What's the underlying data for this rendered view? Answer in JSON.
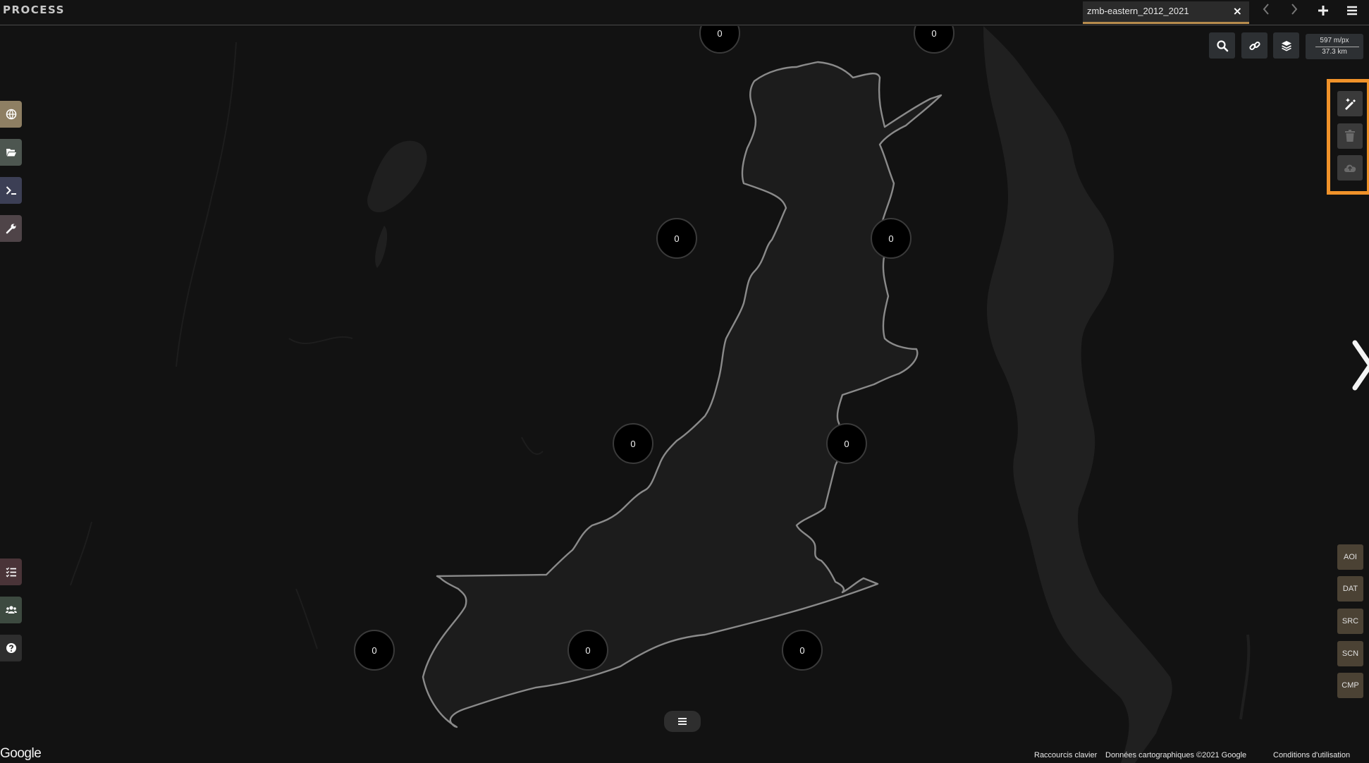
{
  "app": {
    "title": "PROCESS"
  },
  "tab": {
    "label": "zmb-eastern_2012_2021",
    "close_label": "×"
  },
  "top_controls": [
    "chevron-left-icon",
    "chevron-right-icon",
    "plus-icon",
    "hamburger-icon"
  ],
  "map_tools": [
    "search-icon",
    "link-icon",
    "layers-icon"
  ],
  "scale": {
    "resolution": "597 m/px",
    "distance": "37.3 km"
  },
  "left_sidebar": [
    {
      "icon": "globe-icon",
      "color": "#8e7f63"
    },
    {
      "icon": "folder-open-icon",
      "color": "#4d5650"
    },
    {
      "icon": "terminal-icon",
      "color": "#3c3f55"
    },
    {
      "icon": "wrench-icon",
      "color": "#4f4448"
    },
    {
      "icon": "tasks-list-icon",
      "color": "#4a3438"
    },
    {
      "icon": "users-icon",
      "color": "#3d4a40"
    },
    {
      "icon": "help-icon",
      "color": "#2e2e2e"
    }
  ],
  "draw_tools": [
    "draw-polygon-icon",
    "trash-icon",
    "cloud-upload-icon"
  ],
  "highlight_color": "#f0922a",
  "layer_buttons": [
    "AOI",
    "DAT",
    "SRC",
    "SCN",
    "CMP"
  ],
  "clusters": [
    {
      "id": "a",
      "count": "0"
    },
    {
      "id": "b",
      "count": "0"
    },
    {
      "id": "c",
      "count": "0"
    },
    {
      "id": "d",
      "count": "0"
    },
    {
      "id": "e",
      "count": "0"
    },
    {
      "id": "f",
      "count": "0"
    },
    {
      "id": "g",
      "count": "0"
    },
    {
      "id": "h",
      "count": "0"
    },
    {
      "id": "i",
      "count": "0"
    }
  ],
  "bottom_menu_icon": "hamburger-icon",
  "footer": {
    "logo": "Google",
    "shortcuts": "Raccourcis clavier",
    "map_data": "Données cartographiques ©2021 Google",
    "terms": "Conditions d'utilisation"
  }
}
